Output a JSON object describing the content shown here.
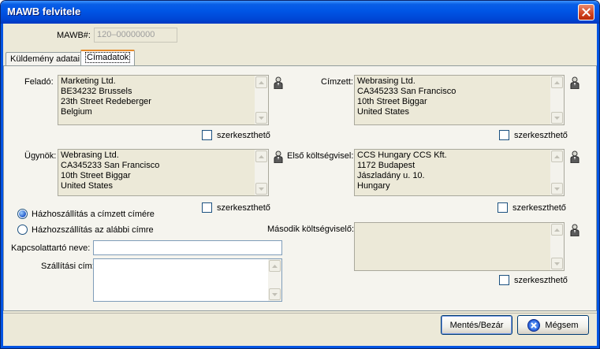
{
  "window": {
    "title": "MAWB felvitele"
  },
  "mawb": {
    "label": "MAWB#:",
    "value": "120–00000000"
  },
  "tabs": [
    {
      "label": "Küldemény adatai"
    },
    {
      "label": "Címadatok"
    }
  ],
  "sender": {
    "label": "Feladó:",
    "lines": [
      "Marketing Ltd.",
      "BE34232 Brussels",
      "23th Street Redeberger",
      "Belgium"
    ],
    "editable_label": "szerkeszthető"
  },
  "recipient": {
    "label": "Címzett:",
    "lines": [
      "Webrasing Ltd.",
      "CA345233 San Francisco",
      "10th Street Biggar",
      "United States"
    ],
    "editable_label": "szerkeszthető"
  },
  "agent": {
    "label": "Ügynök:",
    "lines": [
      "Webrasing Ltd.",
      "CA345233 San Francisco",
      "10th Street Biggar",
      "United States"
    ],
    "editable_label": "szerkeszthető"
  },
  "first_cost_bearer": {
    "label": "Első költségvisel:",
    "lines": [
      "CCS Hungary CCS Kft.",
      "1172 Budapest",
      "Jászladány u. 10.",
      "Hungary"
    ],
    "editable_label": "szerkeszthető"
  },
  "second_cost_bearer": {
    "label": "Második költségviselő:",
    "lines": [],
    "editable_label": "szerkeszthető"
  },
  "delivery": {
    "option_recipient": "Házhoszállítás a címzett címére",
    "option_below": "Házhozszállítás az alábbi címre",
    "selected": "recipient",
    "contact_label": "Kapcsolattartó neve:",
    "contact_value": "",
    "address_label": "Szállítási cím:",
    "address_value": ""
  },
  "buttons": {
    "save_close": "Mentés/Bezár",
    "cancel": "Mégsem"
  },
  "colors": {
    "titlebar": "#0055e5",
    "window_bg": "#ece9d8",
    "close_btn": "#d1431f",
    "radio_selected": "#1f57c8"
  }
}
